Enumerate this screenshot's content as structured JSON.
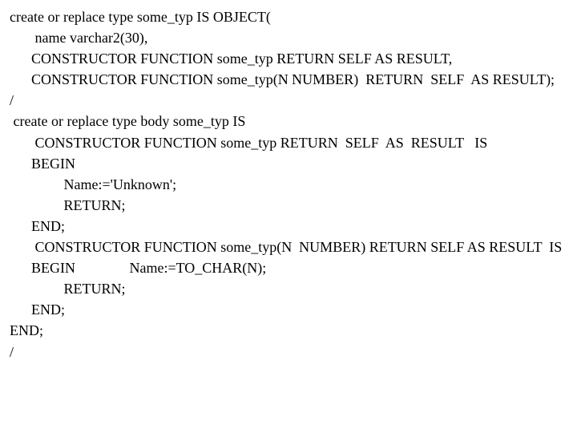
{
  "code": {
    "l1": "create or replace type some_typ IS OBJECT(",
    "l2": "       name varchar2(30),",
    "l3": "      CONSTRUCTOR FUNCTION some_typ RETURN SELF AS RESULT,",
    "l4": "      CONSTRUCTOR FUNCTION some_typ(N NUMBER)  RETURN  SELF  AS RESULT);",
    "l5": "/",
    "l6": " create or replace type body some_typ IS",
    "l7": "       CONSTRUCTOR FUNCTION some_typ RETURN  SELF  AS  RESULT   IS",
    "l8": "      BEGIN",
    "l9": "               Name:='Unknown';",
    "l10": "               RETURN;",
    "l11": "      END;",
    "l12": "       CONSTRUCTOR FUNCTION some_typ(N  NUMBER) RETURN SELF AS RESULT  IS",
    "l13": "      BEGIN               Name:=TO_CHAR(N);",
    "l14": "               RETURN;",
    "l15": "      END;",
    "l16": "END;",
    "l17": "/"
  }
}
